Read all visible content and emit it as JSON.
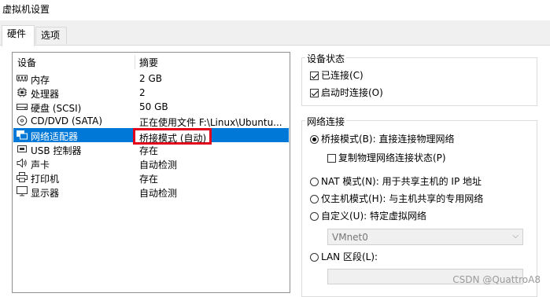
{
  "window": {
    "title": "虚拟机设置"
  },
  "tabs": [
    {
      "label": "硬件"
    },
    {
      "label": "选项"
    }
  ],
  "device_list": {
    "col_device": "设备",
    "col_summary": "摘要",
    "rows": [
      {
        "icon": "memory-icon",
        "name": "内存",
        "summary": "2 GB"
      },
      {
        "icon": "processor-icon",
        "name": "处理器",
        "summary": "2"
      },
      {
        "icon": "hard-disk-icon",
        "name": "硬盘 (SCSI)",
        "summary": "50 GB"
      },
      {
        "icon": "cd-dvd-icon",
        "name": "CD/DVD (SATA)",
        "summary": "正在使用文件 F:\\Linux\\Ubuntu..."
      },
      {
        "icon": "network-adapter-icon",
        "name": "网络适配器",
        "summary": "桥接模式 (自动)"
      },
      {
        "icon": "usb-icon",
        "name": "USB 控制器",
        "summary": "存在"
      },
      {
        "icon": "sound-card-icon",
        "name": "声卡",
        "summary": "自动检测"
      },
      {
        "icon": "printer-icon",
        "name": "打印机",
        "summary": "存在"
      },
      {
        "icon": "display-icon",
        "name": "显示器",
        "summary": "自动检测"
      }
    ],
    "selected_index": 4
  },
  "device_status": {
    "legend": "设备状态",
    "connected": {
      "label": "已连接(C)",
      "checked": true
    },
    "connect_at_power_on": {
      "label": "启动时连接(O)",
      "checked": true
    }
  },
  "network_connection": {
    "legend": "网络连接",
    "bridged": {
      "label": "桥接模式(B): 直接连接物理网络",
      "selected": true
    },
    "replicate": {
      "label": "复制物理网络连接状态(P)",
      "checked": false
    },
    "nat": {
      "label": "NAT 模式(N): 用于共享主机的 IP 地址",
      "selected": false
    },
    "host_only": {
      "label": "仅主机模式(H): 与主机共享的专用网络",
      "selected": false
    },
    "custom": {
      "label": "自定义(U): 特定虚拟网络",
      "selected": false
    },
    "custom_select_value": "VMnet0",
    "lan_segment": {
      "label": "LAN 区段(L):",
      "selected": false
    }
  },
  "watermark": "CSDN @QuattroA8",
  "colors": {
    "selection": "#0078d7",
    "highlight_border": "#e3001b"
  }
}
